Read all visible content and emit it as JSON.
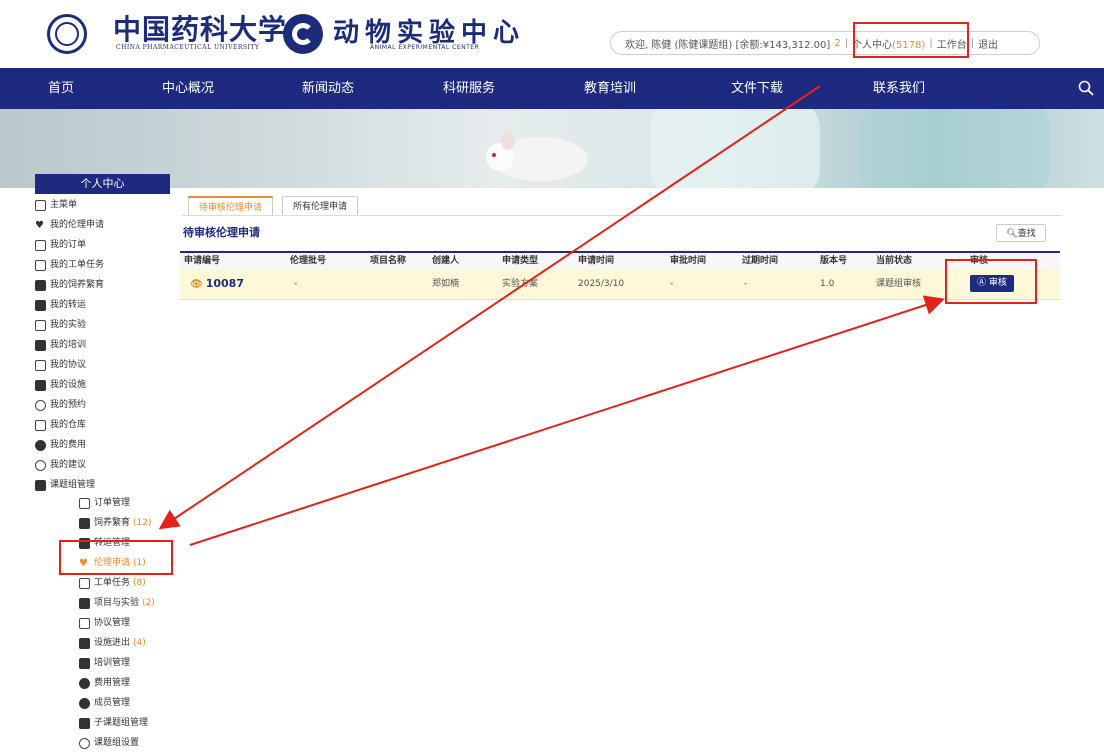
{
  "header": {
    "university_cn": "中国药科大学",
    "university_en": "CHINA PHARMACEUTICAL UNIVERSITY",
    "center_cn": "动物实验中心",
    "center_en": "ANIMAL EXPERIMENTAL CENTER"
  },
  "userbar": {
    "welcome": "欢迎, 陈健 (陈健课题组) [余额:¥143,312.00]",
    "msg_count": "2",
    "personal_center": "个人中心",
    "personal_count": "(5178)",
    "workbench": "工作台",
    "logout": "退出",
    "separator": "|"
  },
  "nav": {
    "items": [
      "首页",
      "中心概况",
      "新闻动态",
      "科研服务",
      "教育培训",
      "文件下载",
      "联系我们"
    ]
  },
  "sidebar": {
    "title": "个人中心",
    "items": [
      {
        "label": "主菜单",
        "icon": "home-icon"
      },
      {
        "label": "我的伦理申请",
        "icon": "heart-icon"
      },
      {
        "label": "我的订单",
        "icon": "order-icon"
      },
      {
        "label": "我的工单任务",
        "icon": "task-icon"
      },
      {
        "label": "我的饲养繁育",
        "icon": "breeding-icon"
      },
      {
        "label": "我的转运",
        "icon": "transport-icon"
      },
      {
        "label": "我的实验",
        "icon": "experiment-icon"
      },
      {
        "label": "我的培训",
        "icon": "training-icon"
      },
      {
        "label": "我的协议",
        "icon": "agreement-icon"
      },
      {
        "label": "我的设施",
        "icon": "facility-icon"
      },
      {
        "label": "我的预约",
        "icon": "clock-icon"
      },
      {
        "label": "我的仓库",
        "icon": "warehouse-icon"
      },
      {
        "label": "我的费用",
        "icon": "fee-icon"
      },
      {
        "label": "我的建议",
        "icon": "suggestion-icon"
      },
      {
        "label": "课题组管理",
        "icon": "group-icon"
      }
    ],
    "sub_items": [
      {
        "label": "订单管理",
        "count": "",
        "icon": "order-icon"
      },
      {
        "label": "饲养繁育",
        "count": "(12)",
        "icon": "breeding-icon"
      },
      {
        "label": "转运管理",
        "count": "",
        "icon": "transport-icon"
      },
      {
        "label": "伦理申请",
        "count": "(1)",
        "icon": "heart-icon"
      },
      {
        "label": "工单任务",
        "count": "(8)",
        "icon": "task-icon"
      },
      {
        "label": "项目与实验",
        "count": "(2)",
        "icon": "project-icon"
      },
      {
        "label": "协议管理",
        "count": "",
        "icon": "agreement-icon"
      },
      {
        "label": "设施进出",
        "count": "(4)",
        "icon": "facility-icon"
      },
      {
        "label": "培训管理",
        "count": "",
        "icon": "training-icon"
      },
      {
        "label": "费用管理",
        "count": "",
        "icon": "fee-icon"
      },
      {
        "label": "成员管理",
        "count": "",
        "icon": "member-icon"
      },
      {
        "label": "子课题组管理",
        "count": "",
        "icon": "subgroup-icon"
      },
      {
        "label": "课题组设置",
        "count": "",
        "icon": "settings-icon"
      }
    ]
  },
  "tabs": [
    "待审核伦理申请",
    "所有伦理申请"
  ],
  "main": {
    "section_title": "待审核伦理申请",
    "find_button": "查找"
  },
  "table": {
    "columns": [
      "申请编号",
      "伦理批号",
      "项目名称",
      "创建人",
      "申请类型",
      "申请时间",
      "审批时间",
      "过期时间",
      "版本号",
      "当前状态",
      "审核"
    ],
    "rows": [
      {
        "id": "10087",
        "batch": "-",
        "project": "",
        "creator": "郑如楠",
        "type": "实验方案",
        "applied": "2025/3/10",
        "approved": "-",
        "expires": "-",
        "version": "1.0",
        "status": "课题组审核",
        "action": "审核"
      }
    ]
  },
  "colors": {
    "brand": "#1d2a80",
    "accent": "#f08a24",
    "highlight": "#e2231a"
  }
}
